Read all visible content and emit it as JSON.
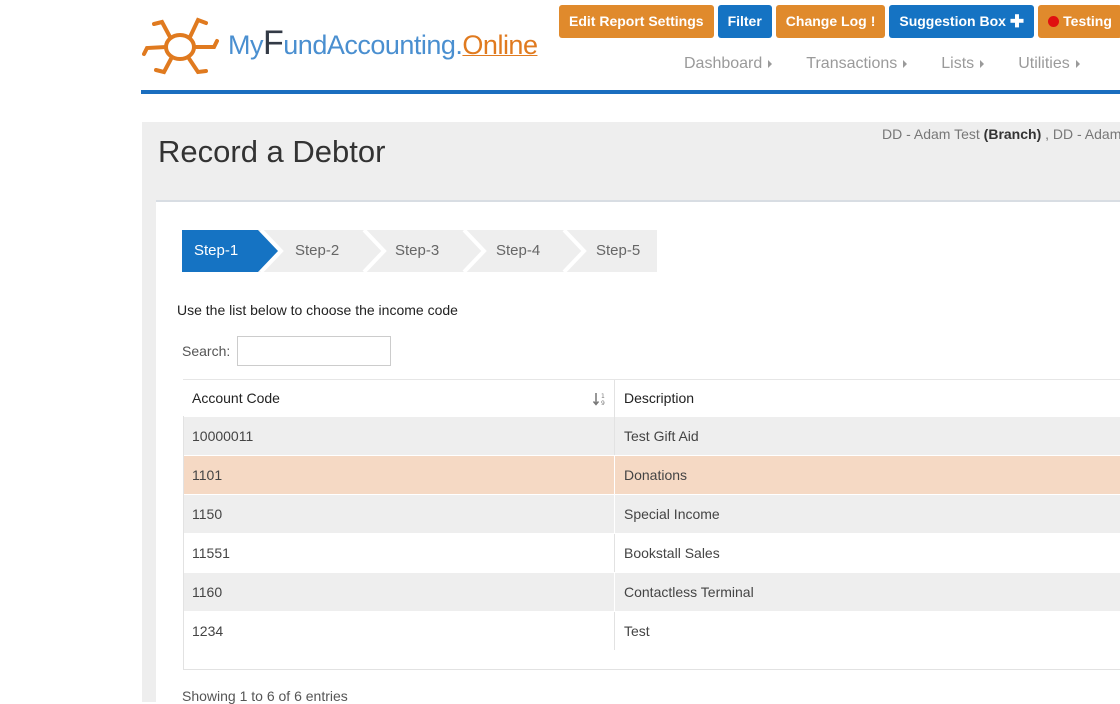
{
  "brand": {
    "logo_my": "My",
    "logo_f": "F",
    "logo_rest": "undAccounting.",
    "logo_online": "Online",
    "colors": {
      "blue": "#4a8fd0",
      "orange": "#e07a1f",
      "dark": "#333a46"
    }
  },
  "top_buttons": [
    {
      "label": "Edit Report Settings",
      "color": "#e08a2c"
    },
    {
      "label": "Filter",
      "color": "#1573c3"
    },
    {
      "label": "Change Log",
      "color": "#e08a2c",
      "icon": "exclamation-icon"
    },
    {
      "label": "Suggestion Box",
      "color": "#1573c3",
      "icon": "plus-icon"
    },
    {
      "label": "Testing",
      "color": "#e08a2c",
      "icon": "red-dot-icon"
    }
  ],
  "nav": {
    "items": [
      "Dashboard",
      "Transactions",
      "Lists",
      "Utilities"
    ]
  },
  "page": {
    "title": "Record a Debtor",
    "context_prefix": "DD - Adam Test ",
    "context_bold": "(Branch)",
    "context_suffix": " , DD - Adam"
  },
  "steps": {
    "items": [
      "Step-1",
      "Step-2",
      "Step-3",
      "Step-4",
      "Step-5"
    ],
    "active_index": 0,
    "active_color": "#1573c3"
  },
  "instruction": "Use the list below to choose the income code",
  "search": {
    "label": "Search:",
    "value": ""
  },
  "table": {
    "columns": [
      "Account Code",
      "Description"
    ],
    "sort_icon": "sort-numeric-icon",
    "rows": [
      {
        "code": "10000011",
        "description": "Test Gift Aid"
      },
      {
        "code": "1101",
        "description": "Donations",
        "selected": true
      },
      {
        "code": "1150",
        "description": "Special Income"
      },
      {
        "code": "11551",
        "description": "Bookstall Sales"
      },
      {
        "code": "1160",
        "description": "Contactless Terminal"
      },
      {
        "code": "1234",
        "description": "Test"
      }
    ],
    "info": "Showing 1 to 6 of 6 entries"
  }
}
